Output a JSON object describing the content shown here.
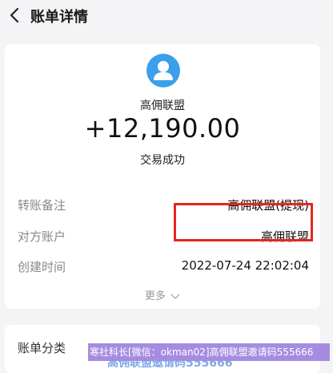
{
  "header": {
    "title": "账单详情"
  },
  "summary": {
    "merchant": "高佣联盟",
    "amount": "+12,190.00",
    "status": "交易成功"
  },
  "details": [
    {
      "label": "转账备注",
      "value": "高佣联盟(提现)"
    },
    {
      "label": "对方账户",
      "value": "高佣联盟"
    },
    {
      "label": "创建时间",
      "value": "2022-07-24 22:02:04"
    }
  ],
  "more_label": "更多",
  "category_label": "账单分类",
  "watermark": {
    "line1": "寒社科长[微信：okman02]高佣联盟邀请码555666",
    "line2": "高佣联盟邀请码555666"
  },
  "colors": {
    "avatar": "#3aa0ea",
    "highlight": "#e5261f"
  }
}
